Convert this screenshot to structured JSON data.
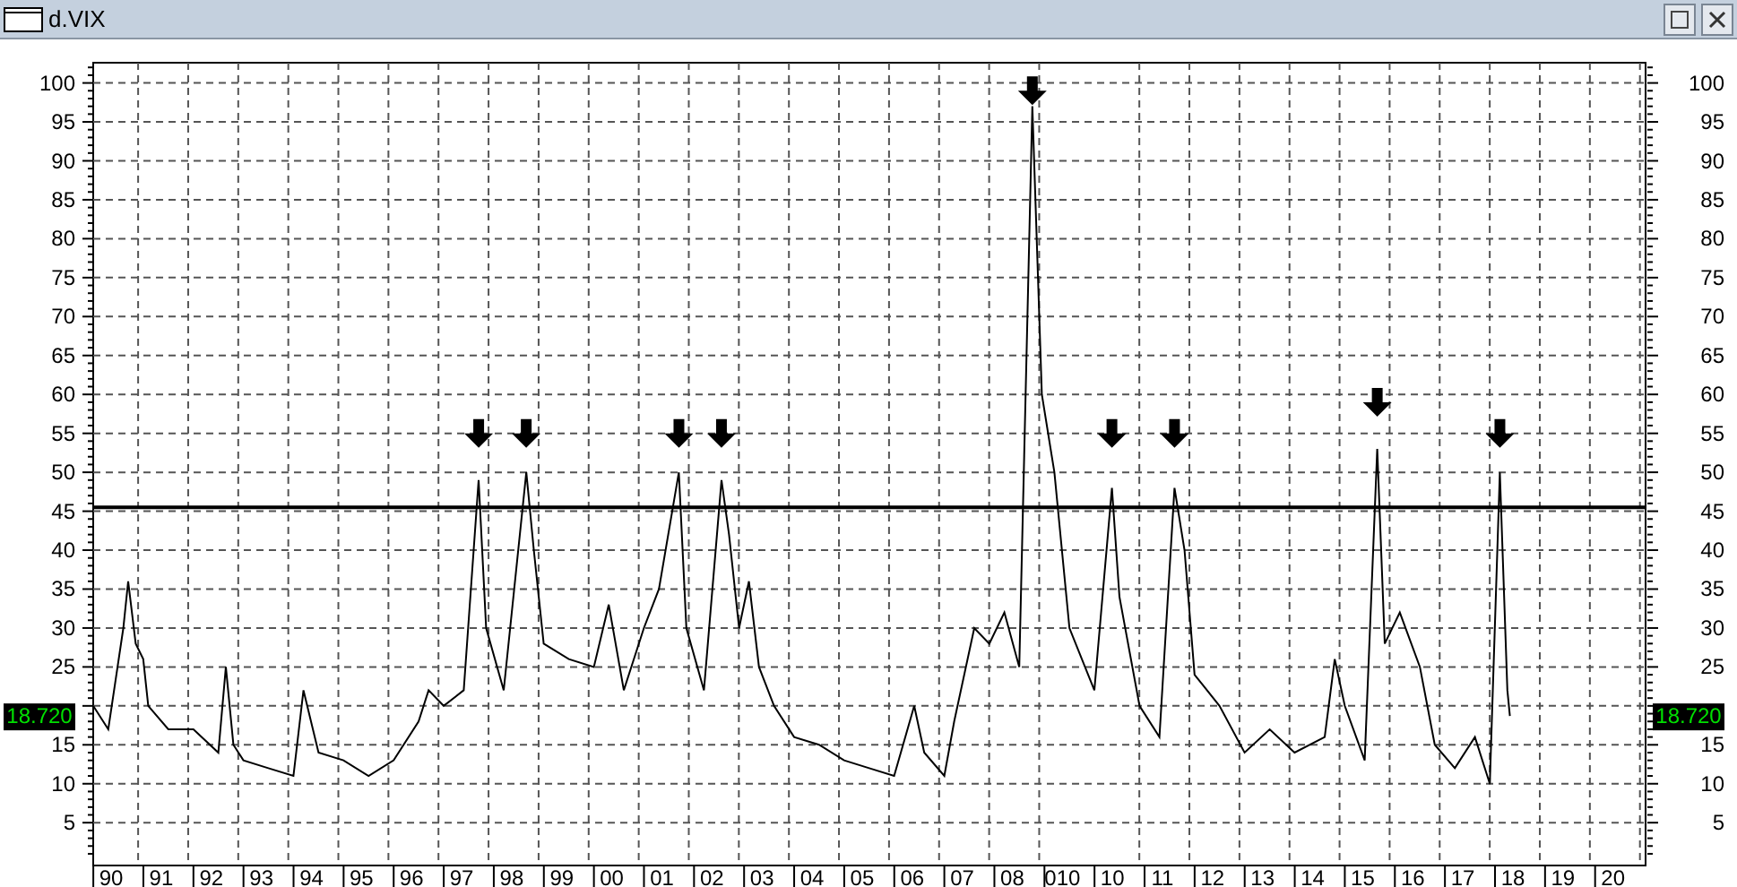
{
  "window": {
    "title": "d.VIX"
  },
  "last_value_labels": [
    "18.720",
    "18.720"
  ],
  "x_axis_extra_labels": [
    "010"
  ],
  "right_axis": {
    "labels": [
      "100",
      "95",
      "90",
      "85",
      "80",
      "75",
      "70",
      "65",
      "60",
      "55",
      "50",
      "45",
      "40",
      "35",
      "30",
      "25",
      "15",
      "10",
      "5"
    ]
  },
  "chart_data": {
    "type": "line",
    "grid": true,
    "xlim": [
      1989.64,
      2020.65
    ],
    "ylim": [
      -0.5,
      102.6
    ],
    "yticks": [
      5,
      10,
      15,
      25,
      30,
      35,
      40,
      45,
      50,
      55,
      60,
      65,
      70,
      75,
      80,
      85,
      90,
      95,
      100
    ],
    "xticks": [
      {
        "value": 1990,
        "label": "90"
      },
      {
        "value": 1991,
        "label": "91"
      },
      {
        "value": 1992,
        "label": "92"
      },
      {
        "value": 1993,
        "label": "93"
      },
      {
        "value": 1994,
        "label": "94"
      },
      {
        "value": 1995,
        "label": "95"
      },
      {
        "value": 1996,
        "label": "96"
      },
      {
        "value": 1997,
        "label": "97"
      },
      {
        "value": 1998,
        "label": "98"
      },
      {
        "value": 1999,
        "label": "99"
      },
      {
        "value": 2000,
        "label": "00"
      },
      {
        "value": 2001,
        "label": "01"
      },
      {
        "value": 2002,
        "label": "02"
      },
      {
        "value": 2003,
        "label": "03"
      },
      {
        "value": 2004,
        "label": "04"
      },
      {
        "value": 2005,
        "label": "05"
      },
      {
        "value": 2006,
        "label": "06"
      },
      {
        "value": 2007,
        "label": "07"
      },
      {
        "value": 2008,
        "label": "08"
      },
      {
        "value": 2010,
        "label": "10"
      },
      {
        "value": 2011,
        "label": "11"
      },
      {
        "value": 2012,
        "label": "12"
      },
      {
        "value": 2013,
        "label": "13"
      },
      {
        "value": 2014,
        "label": "14"
      },
      {
        "value": 2015,
        "label": "15"
      },
      {
        "value": 2016,
        "label": "16"
      },
      {
        "value": 2017,
        "label": "17"
      },
      {
        "value": 2018,
        "label": "18"
      },
      {
        "value": 2019,
        "label": "19"
      },
      {
        "value": 2020,
        "label": "20"
      }
    ],
    "x": [
      1989.64,
      1989.94,
      1990.24,
      1990.34,
      1990.49,
      1990.64,
      1990.74,
      1991.14,
      1991.64,
      1992.14,
      1992.29,
      1992.44,
      1992.64,
      1993.14,
      1993.64,
      1993.84,
      1994.14,
      1994.64,
      1995.14,
      1995.64,
      1996.14,
      1996.34,
      1996.64,
      1997.04,
      1997.34,
      1997.49,
      1997.84,
      1998.29,
      1998.44,
      1998.64,
      1999.14,
      1999.64,
      1999.94,
      2000.24,
      2000.64,
      2000.94,
      2001.34,
      2001.49,
      2001.84,
      2002.19,
      2002.34,
      2002.54,
      2002.74,
      2002.94,
      2003.24,
      2003.64,
      2004.14,
      2004.64,
      2005.14,
      2005.64,
      2006.04,
      2006.24,
      2006.64,
      2006.84,
      2007.24,
      2007.54,
      2007.84,
      2008.14,
      2008.4,
      2008.59,
      2008.84,
      2009.14,
      2009.64,
      2009.99,
      2010.14,
      2010.54,
      2010.94,
      2011.24,
      2011.44,
      2011.64,
      2012.14,
      2012.64,
      2013.14,
      2013.64,
      2014.24,
      2014.44,
      2014.64,
      2015.04,
      2015.29,
      2015.44,
      2015.74,
      2016.14,
      2016.44,
      2016.84,
      2017.24,
      2017.54,
      2017.74,
      2017.89,
      2017.94
    ],
    "series": [
      {
        "color": "#000000",
        "values": [
          20,
          17,
          30,
          36,
          28,
          26,
          20,
          17,
          17,
          14,
          25,
          15,
          13,
          12,
          11,
          22,
          14,
          13,
          11,
          13,
          18,
          22,
          20,
          22,
          49,
          30,
          22,
          50,
          40,
          28,
          26,
          25,
          33,
          22,
          30,
          35,
          50,
          30,
          22,
          49,
          42,
          30,
          36,
          25,
          20,
          16,
          15,
          13,
          12,
          11,
          20,
          14,
          11,
          18,
          30,
          28,
          32,
          25,
          97,
          60,
          50,
          30,
          22,
          48,
          34,
          20,
          16,
          48,
          40,
          24,
          20,
          14,
          17,
          14,
          16,
          26,
          20,
          13,
          53,
          28,
          32,
          25,
          15,
          12,
          16,
          10,
          50,
          22,
          18.7
        ]
      },
      {
        "color": "#000000",
        "marker": "triangle",
        "values": [
          null,
          null,
          null,
          null,
          null,
          null,
          null,
          null,
          null,
          null,
          null,
          null,
          null,
          null,
          null,
          null,
          null,
          null,
          null,
          null,
          null,
          null,
          null,
          null,
          55,
          null,
          null,
          55,
          null,
          null,
          null,
          null,
          null,
          null,
          null,
          null,
          55,
          null,
          null,
          55,
          null,
          null,
          null,
          null,
          null,
          null,
          null,
          null,
          null,
          null,
          null,
          null,
          null,
          null,
          null,
          null,
          null,
          null,
          99,
          null,
          null,
          null,
          null,
          55,
          null,
          null,
          null,
          55,
          null,
          null,
          null,
          null,
          null,
          null,
          null,
          null,
          null,
          null,
          59,
          null,
          null,
          null,
          null,
          null,
          null,
          null,
          55,
          null,
          null
        ]
      }
    ],
    "ref_lines": [
      {
        "axis": "y",
        "value": 45.5
      }
    ]
  }
}
